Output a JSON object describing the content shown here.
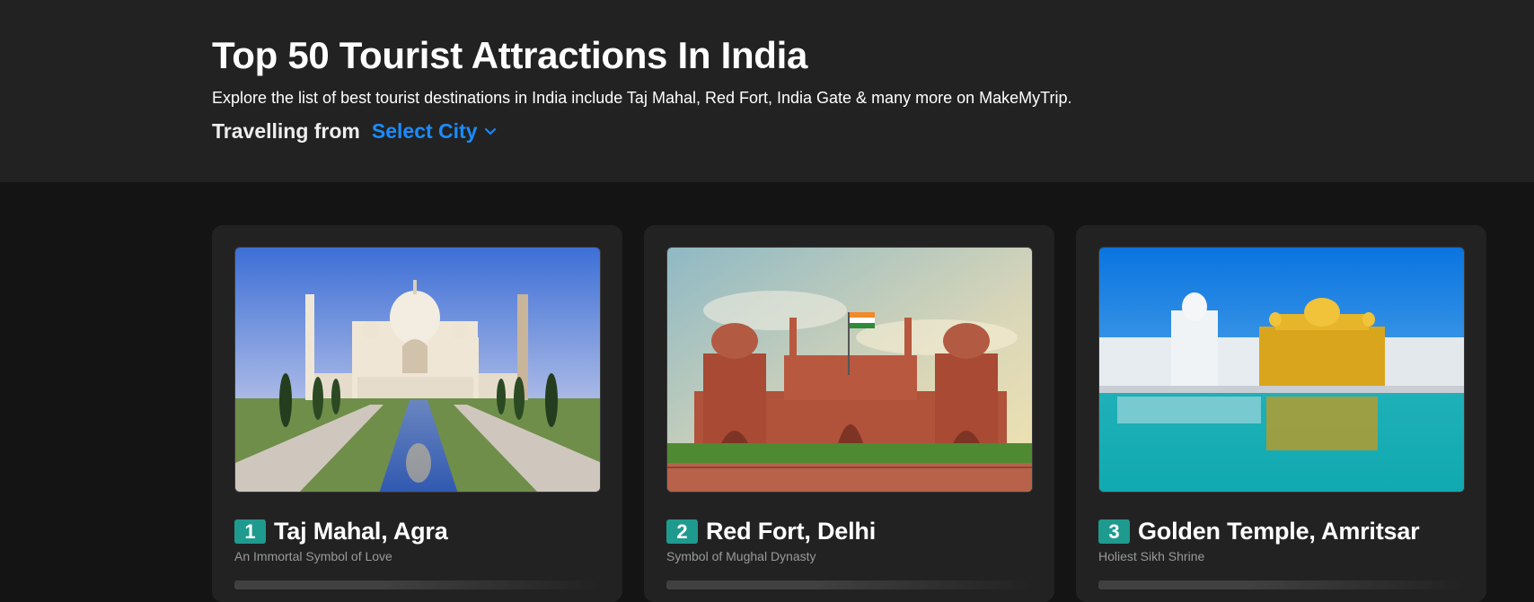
{
  "header": {
    "title": "Top 50 Tourist Attractions In India",
    "subtitle": "Explore the list of best tourist destinations in India include Taj Mahal, Red Fort, India Gate & many more on MakeMyTrip.",
    "travelling_from_label": "Travelling from",
    "select_city_label": "Select City"
  },
  "colors": {
    "accent_blue": "#1a8cff",
    "rank_badge": "#1f9a8f",
    "header_bg": "#222222",
    "page_bg": "#141414"
  },
  "attractions": [
    {
      "rank": "1",
      "name": "Taj Mahal, Agra",
      "tagline": "An Immortal Symbol of Love",
      "image": "taj-mahal-photo"
    },
    {
      "rank": "2",
      "name": "Red Fort, Delhi",
      "tagline": "Symbol of Mughal Dynasty",
      "image": "red-fort-photo"
    },
    {
      "rank": "3",
      "name": "Golden Temple, Amritsar",
      "tagline": "Holiest Sikh Shrine",
      "image": "golden-temple-photo"
    }
  ]
}
